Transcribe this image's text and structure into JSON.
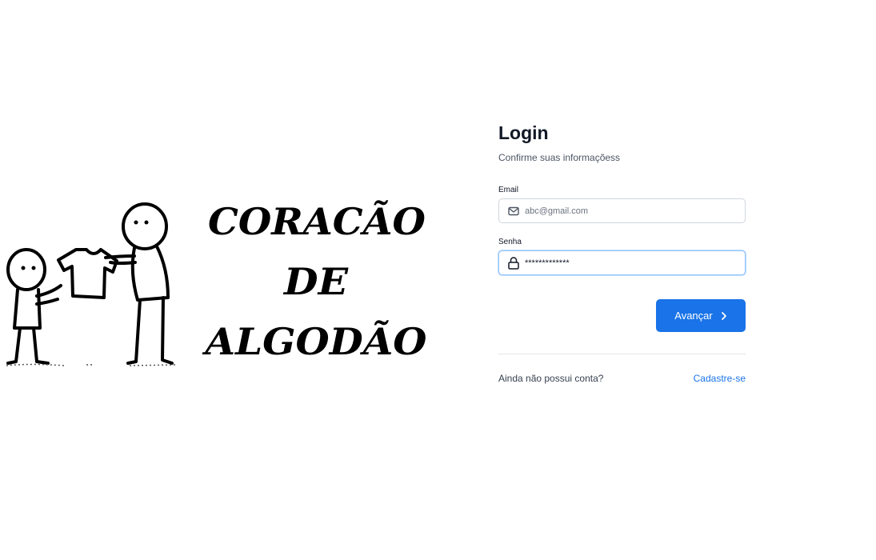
{
  "brand": {
    "logo_lines": [
      "CORACÃO",
      "DE",
      "ALGODÃO"
    ]
  },
  "login": {
    "title": "Login",
    "subtitle": "Confirme suas informaçõess",
    "email": {
      "label": "Email",
      "placeholder": "abc@gmail.com",
      "value": "",
      "icon": "mail-icon"
    },
    "password": {
      "label": "Senha",
      "value": "*************",
      "icon": "lock-icon"
    },
    "submit_label": "Avançar",
    "submit_icon": "chevron-right-icon",
    "footer_text": "Ainda não possui conta?",
    "signup_label": "Cadastre-se"
  },
  "colors": {
    "accent": "#1a73e8",
    "title": "#111827",
    "muted": "#4b5563",
    "border": "#d1d5db"
  }
}
